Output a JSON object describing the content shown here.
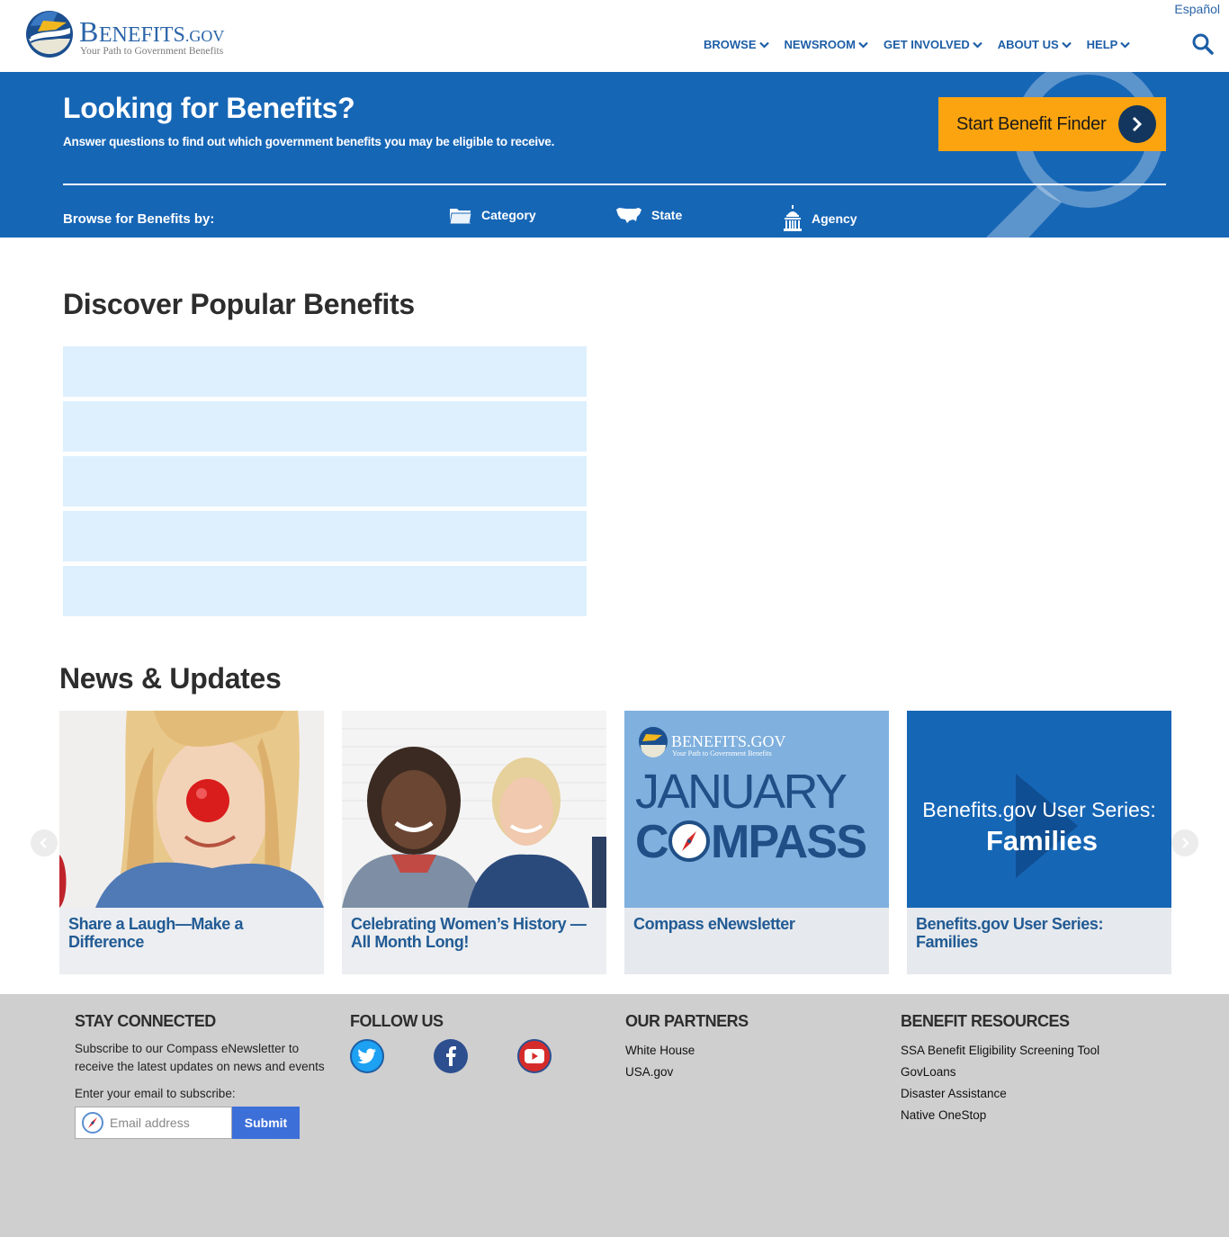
{
  "header": {
    "logo": {
      "word_first": "B",
      "word_rest": "ENEFITS",
      "word_tld": ".GOV",
      "tagline": "Your Path to Government Benefits"
    },
    "language_link": "Español",
    "nav": [
      {
        "label": "BROWSE"
      },
      {
        "label": "NEWSROOM"
      },
      {
        "label": "GET INVOLVED"
      },
      {
        "label": "ABOUT US"
      },
      {
        "label": "HELP"
      }
    ]
  },
  "hero": {
    "title": "Looking for Benefits?",
    "subtitle": "Answer questions to find out which government benefits you may be eligible to receive.",
    "cta": "Start Benefit Finder",
    "browse_label": "Browse for Benefits by:",
    "browse_links": [
      {
        "label": "Category",
        "icon": "folder-icon"
      },
      {
        "label": "State",
        "icon": "us-map-icon"
      },
      {
        "label": "Agency",
        "icon": "capitol-building-icon"
      }
    ]
  },
  "discover": {
    "title": "Discover Popular Benefits",
    "item_count": 5
  },
  "news": {
    "title": "News & Updates",
    "cards": [
      {
        "caption": "Share a Laugh—Make a Difference"
      },
      {
        "caption": "Celebrating Women’s History — All Month Long!"
      },
      {
        "caption": "Compass eNewsletter",
        "image_logo_text": "BENEFITS.GOV",
        "image_tagline": "Your Path to Government Benefits",
        "image_line1": "JANUARY",
        "image_line2_a": "C",
        "image_line2_b": "MPASS"
      },
      {
        "caption": "Benefits.gov User Series: Families",
        "image_line1": "Benefits.gov User Series:",
        "image_line2": "Families"
      }
    ]
  },
  "footer": {
    "stay_connected": {
      "heading": "STAY CONNECTED",
      "text": "Subscribe to our Compass eNewsletter to receive the latest updates on news and events",
      "email_label": "Enter your email to subscribe:",
      "email_placeholder": "Email address",
      "submit": "Submit"
    },
    "follow_us": {
      "heading": "FOLLOW US",
      "networks": [
        "twitter-icon",
        "facebook-icon",
        "youtube-icon"
      ]
    },
    "partners": {
      "heading": "OUR PARTNERS",
      "links": [
        "White House",
        "USA.gov"
      ]
    },
    "resources": {
      "heading": "BENEFIT RESOURCES",
      "links": [
        "SSA Benefit Eligibility Screening Tool",
        "GovLoans",
        "Disaster Assistance",
        "Native OneStop"
      ]
    }
  },
  "colors": {
    "brand_blue": "#1666b6",
    "cta_orange": "#fba40f",
    "nav_blue": "#1d5ea6",
    "popular_item_bg": "#def0fd",
    "footer_bg": "#cfcfcf"
  }
}
